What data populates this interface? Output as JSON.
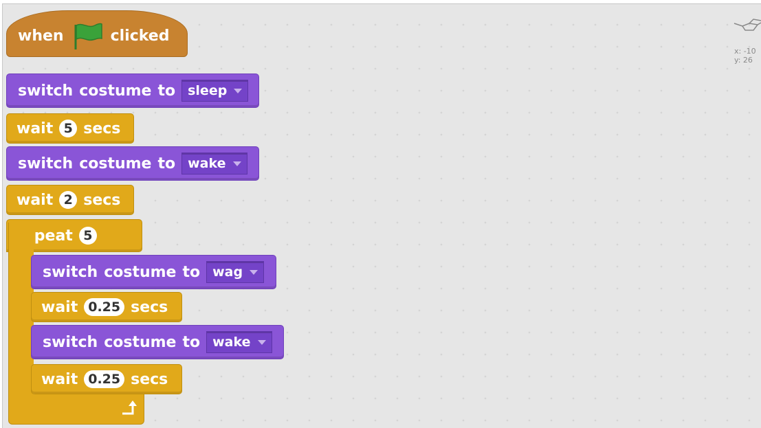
{
  "script": {
    "hat": {
      "word1": "when",
      "word2": "clicked",
      "icon": "green-flag-icon"
    },
    "blocks": [
      {
        "text": [
          "switch",
          "costume",
          "to"
        ],
        "costume": "sleep"
      },
      {
        "wait_word": "wait",
        "value": "5",
        "unit": "secs"
      },
      {
        "text": [
          "switch",
          "costume",
          "to"
        ],
        "costume": "wake"
      },
      {
        "wait_word": "wait",
        "value": "2",
        "unit": "secs"
      },
      {
        "repeat_word": "repeat",
        "value": "5"
      },
      {
        "text": [
          "switch",
          "costume",
          "to"
        ],
        "costume": "wag"
      },
      {
        "wait_word": "wait",
        "value": "0.25",
        "unit": "secs"
      },
      {
        "text": [
          "switch",
          "costume",
          "to"
        ],
        "costume": "wake"
      },
      {
        "wait_word": "wait",
        "value": "0.25",
        "unit": "secs"
      }
    ]
  },
  "sprite_info": {
    "x": "x: -10",
    "y": "y: 26"
  },
  "colors": {
    "looks": "#8a55d7",
    "control": "#e1a91a",
    "events": "#c88330",
    "flag": "#3aa23a",
    "canvas": "#e6e6e6"
  }
}
